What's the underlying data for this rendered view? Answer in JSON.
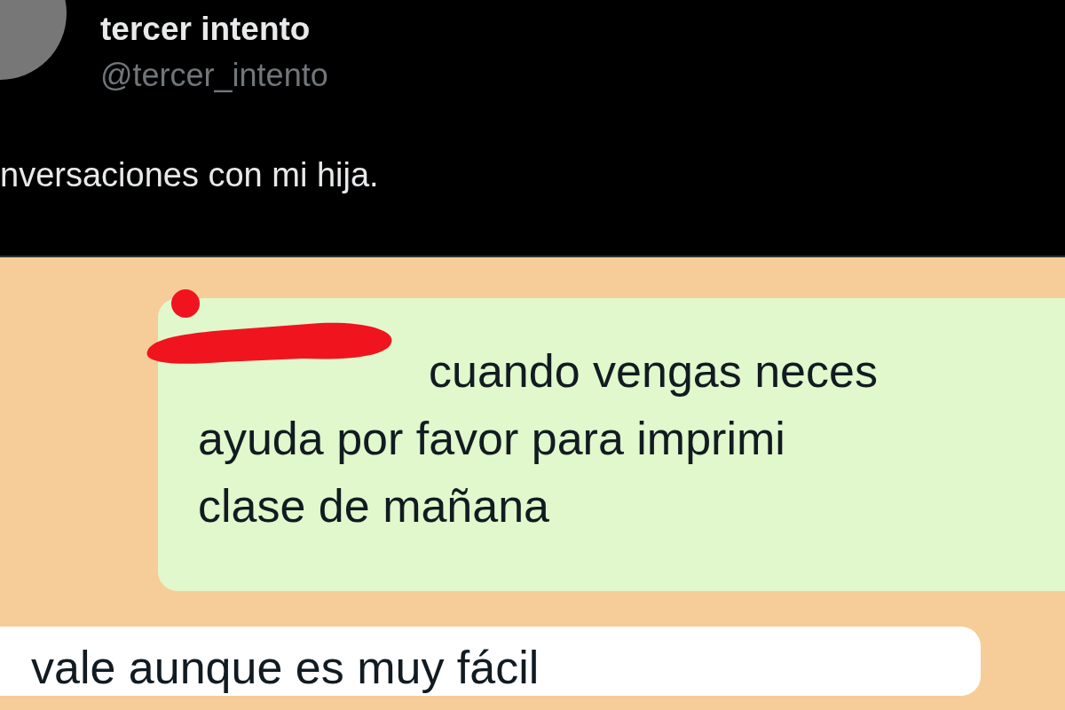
{
  "tweet": {
    "author_name": "tercer intento",
    "handle": "@tercer_intento",
    "text": "nversaciones con mi hija."
  },
  "chat": {
    "messages": [
      {
        "kind": "outgoing",
        "redacted": true,
        "lines": [
          "cuando vengas neces",
          "ayuda por favor para imprimi",
          "clase de mañana"
        ]
      },
      {
        "kind": "incoming",
        "redacted": false,
        "lines": [
          "vale aunque es muy fácil"
        ]
      }
    ]
  }
}
